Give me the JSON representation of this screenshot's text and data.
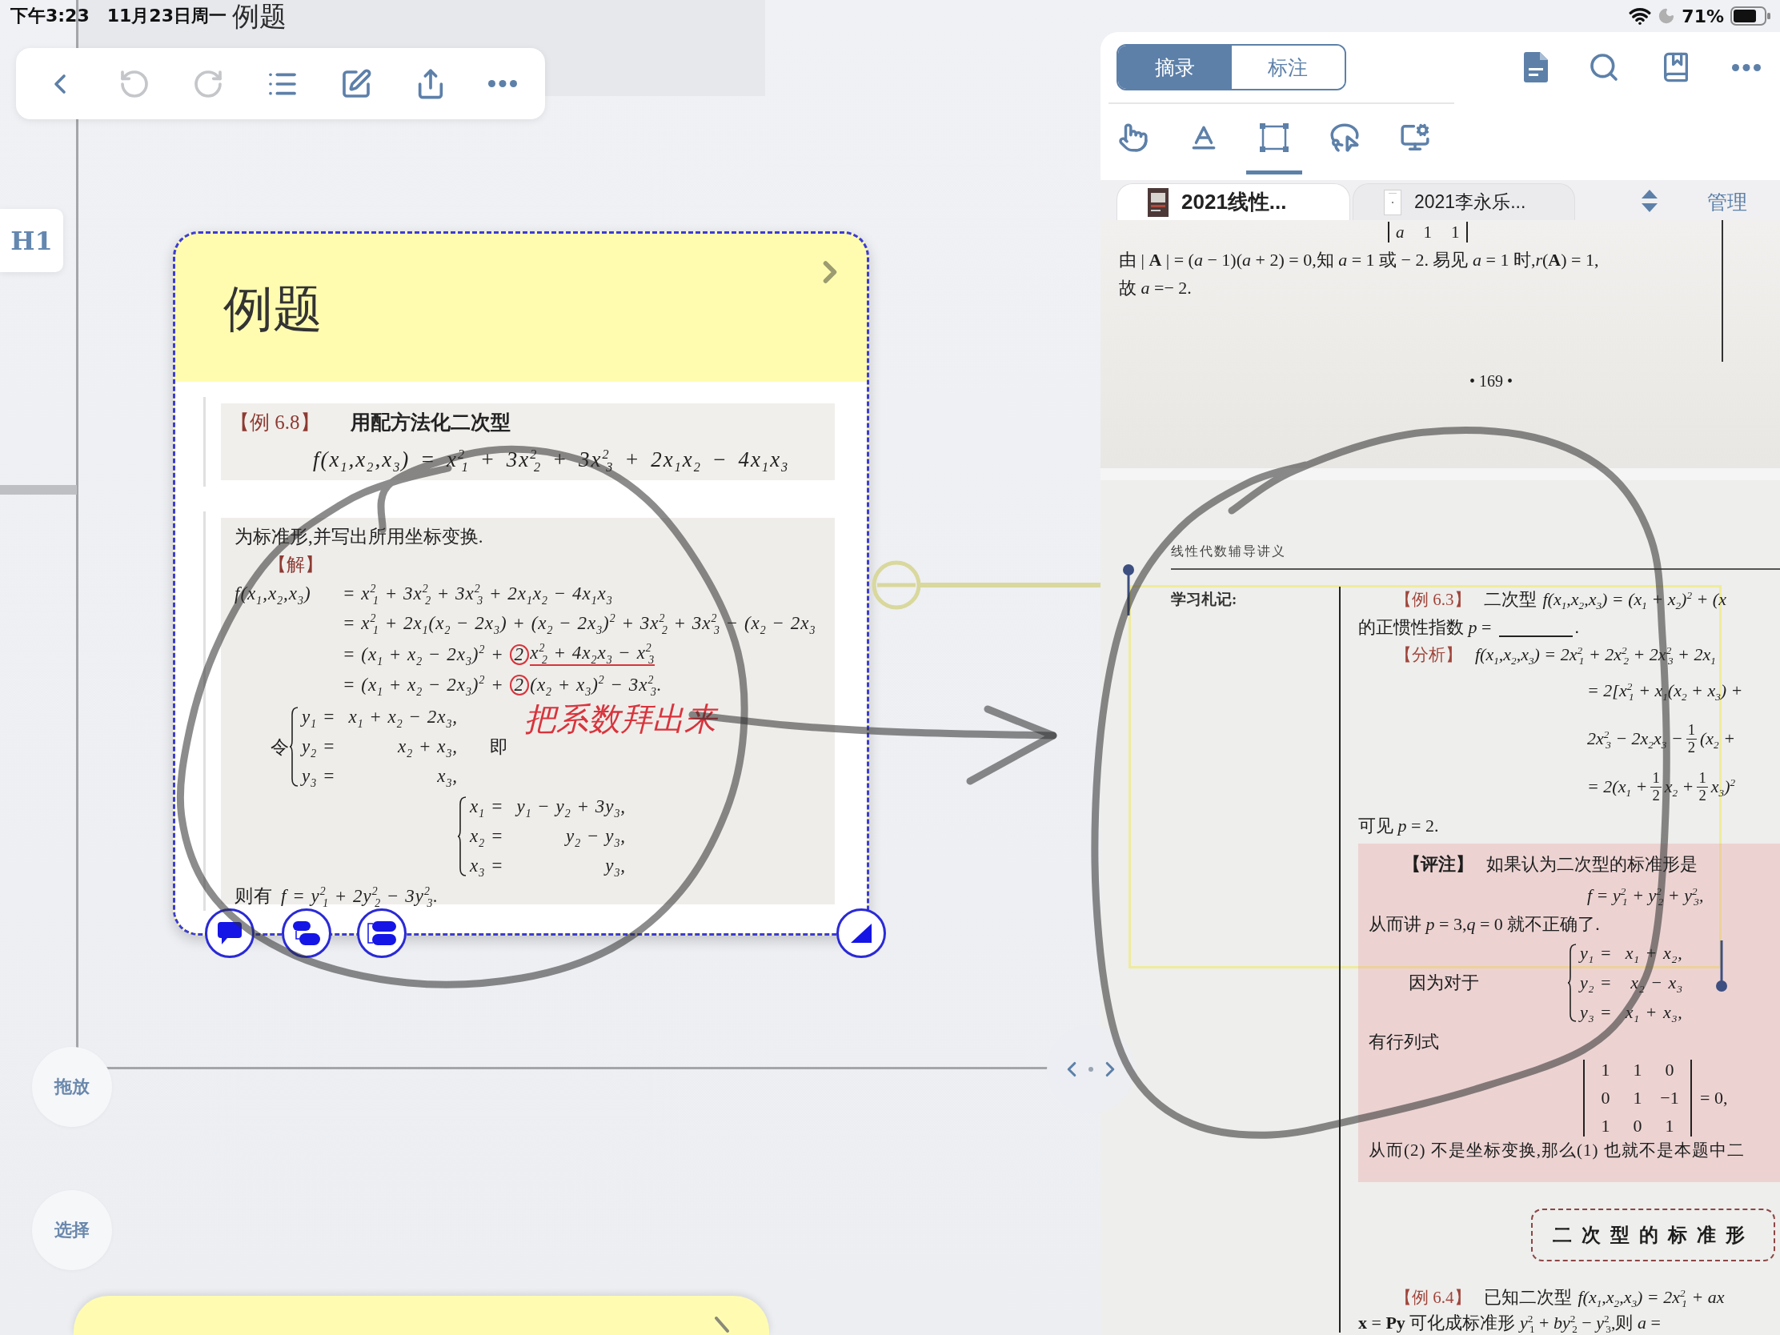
{
  "status_bar": {
    "time": "下午3:23",
    "date": "11月23日周一",
    "battery": "71%"
  },
  "background_card": {
    "title": "例题"
  },
  "toolbar": {
    "buttons": [
      {
        "disabled": false
      },
      {
        "disabled": true
      },
      {
        "disabled": true
      },
      {
        "disabled": false
      },
      {
        "disabled": false
      },
      {
        "disabled": false
      },
      {
        "disabled": false
      }
    ]
  },
  "heading_button": {
    "label": "H1"
  },
  "card": {
    "title": "例题",
    "excerpt_1": {
      "tag": "【例 6.8】",
      "title": "用配方法化二次型",
      "formula": "f(x$_{1}$,x$_{2}$,x$_{3}$) = x$^{2}$$_{1}$ + 3x$^{2}$$_{2}$ + 3x$^{2}$$_{3}$ + 2x$_{1}$x$_{2}$ − 4x$_{1}$x$_{3}$"
    },
    "excerpt_2": {
      "intro": "为标准形,并写出所用坐标变换.",
      "tag": "【解】",
      "derivation": {
        "head": "f(x$_{1}$,x$_{2}$,x$_{3}$)",
        "lines": [
          [
            {
              "kind": "text",
              "text": "= x$^{2}$$_{1}$ + 3x$^{2}$$_{2}$ + 3x$^{2}$$_{3}$ + 2x$_{1}$x$_{2}$ − 4x$_{1}$x$_{3}$"
            }
          ],
          [
            {
              "kind": "text",
              "text": "= x$^{2}$$_{1}$ + 2x$_{1}$(x$_{2}$ − 2x$_{3}$) + (x$_{2}$ − 2x$_{3}$)$^{2}$ + 3x$^{2}$$_{2}$ + 3x$^{2}$$_{3}$ − (x$_{2}$ − 2x$_{3}$"
            }
          ],
          [
            {
              "kind": "text",
              "text": "= (x$_{1}$ + x$_{2}$ − 2x$_{3}$)$^{2}$ +"
            },
            {
              "kind": "circled",
              "text": "2"
            },
            {
              "kind": "underlined",
              "text": "x$^{2}$$_{2}$ + 4x$_{2}$x$_{3}$ − x$^{2}$$_{3}$"
            }
          ],
          [
            {
              "kind": "text",
              "text": "= (x$_{1}$ + x$_{2}$ − 2x$_{3}$)$^{2}$ +"
            },
            {
              "kind": "circled",
              "text": "2"
            },
            {
              "kind": "text",
              "text": "(x$_{2}$ + x$_{3}$)$^{2}$ − 3x$^{2}$$_{3}$."
            }
          ]
        ]
      },
      "let": "令",
      "substitution": [
        {
          "lhs": "y$_{1}$ =",
          "rhs": "x$_{1}$ + x$_{2}$ − 2x$_{3}$,"
        },
        {
          "lhs": "y$_{2}$ =",
          "rhs": "x$_{2}$ + x$_{3}$,"
        },
        {
          "lhs": "y$_{3}$ =",
          "rhs": "x$_{3}$,"
        }
      ],
      "hence": "即",
      "inverse": [
        {
          "lhs": "x$_{1}$ =",
          "rhs": "y$_{1}$ − y$_{2}$ + 3y$_{3}$,"
        },
        {
          "lhs": "x$_{2}$ =",
          "rhs": "y$_{2}$ − y$_{3}$,"
        },
        {
          "lhs": "x$_{3}$ =",
          "rhs": "y$_{3}$,"
        }
      ],
      "result": {
        "lead": "则有",
        "formula": "f = y$^{2}$$_{1}$ + 2y$^{2}$$_{2}$ − 3y$^{2}$$_{3}$."
      }
    },
    "handwritten_note": "把系数拜出来"
  },
  "side_buttons": [
    {
      "label": "拖放"
    },
    {
      "label": "选择"
    }
  ],
  "panel": {
    "modes": [
      {
        "label": "摘录",
        "selected": true
      },
      {
        "label": "标注",
        "selected": false
      }
    ],
    "tools": [
      {
        "selected": false
      },
      {
        "selected": false
      },
      {
        "selected": true
      },
      {
        "selected": false
      },
      {
        "selected": false
      }
    ],
    "doc_tabs": [
      {
        "label": "2021线性...",
        "selected": true
      },
      {
        "label": "2021李永乐...",
        "selected": false
      }
    ],
    "manage": "管理",
    "page_1": {
      "matrix_row": [
        "*a*",
        "1",
        "1"
      ],
      "lines": [
        "由 | **A** | = (*a* − 1)(*a* + 2) = 0,知 *a* = 1 或 − 2. 易见 *a* = 1 时,*r*(**A**) = 1,",
        "故 *a* =− 2."
      ],
      "page_number": "• 169 •"
    },
    "page_2": {
      "header": "线性代数辅导讲义",
      "margin_label": "学习札记:",
      "example": {
        "tag": "【例 6.3】",
        "text": "二次型",
        "formula": "f(x$_{1}$,x$_{2}$,x$_{3}$) = (x$_{1}$ + x$_{2}$)$^{2}$ + (x"
      },
      "question": {
        "before": "的正惯性指数 *p* =",
        "after": "."
      },
      "analysis": {
        "tag": "【分析】",
        "head": "f(x$_{1}$,x$_{2}$,x$_{3}$) = 2x$^{2}$$_{1}$ + 2x$^{2}$$_{2}$ + 2x$^{2}$$_{3}$ + 2x$_{1}$",
        "lines": [
          [
            {
              "kind": "text",
              "text": "= 2[x$^{2}$$_{1}$ + x$_{1}$(x$_{2}$ + x$_{3}$) +"
            }
          ],
          [
            {
              "kind": "text",
              "text": "2x$^{2}$$_{3}$ − 2x$_{2}$x$_{3}$ −"
            },
            {
              "kind": "frac",
              "num": "1",
              "den": "2"
            },
            {
              "kind": "text",
              "text": "(x$_{2}$ +"
            }
          ],
          [
            {
              "kind": "text",
              "text": "= 2(x$_{1}$ +"
            },
            {
              "kind": "frac",
              "num": "1",
              "den": "2"
            },
            {
              "kind": "text",
              "text": "x$_{2}$ +"
            },
            {
              "kind": "frac",
              "num": "1",
              "den": "2"
            },
            {
              "kind": "text",
              "text": "x$_{3}$)$^{2}$"
            }
          ]
        ]
      },
      "conclusion": "可见 *p* = 2.",
      "remark": {
        "tag": "【评注】",
        "text": "如果认为二次型的标准形是",
        "formula": "f = y$^{2}$$_{1}$ + y$^{2}$$_{2}$ + y$^{2}$$_{3}$,",
        "consequence": "从而讲 *p* = 3,*q* = 0 就不正确了.",
        "because": "因为对于",
        "system": [
          {
            "lhs": "y$_{1}$ =",
            "rhs": "x$_{1}$ + x$_{2}$,"
          },
          {
            "lhs": "y$_{2}$ =",
            "rhs": "x$_{2}$ − x$_{3}$"
          },
          {
            "lhs": "y$_{3}$ =",
            "rhs": "x$_{1}$ + x$_{3}$,"
          }
        ],
        "determinant_intro": "有行列式",
        "determinant": [
          [
            "1",
            "1",
            "0"
          ],
          [
            "0",
            "1",
            "−1"
          ],
          [
            "1",
            "0",
            "1"
          ]
        ],
        "determinant_value": "= 0,",
        "conclusion": "从而(2) 不是坐标变换,那么(1) 也就不是本题中二"
      },
      "section_title": "二次型的标准形",
      "next_example": {
        "tag": "【例 6.4】",
        "text": "已知二次型",
        "formula": "f(x$_{1}$,x$_{2}$,x$_{3}$) = 2x$^{2}$$_{1}$ + ax"
      },
      "last_line": "**x** = **Py** 可化成标准形 *y*$^{2}$$_{1}$ + *by*$^{2}$$_{2}$ − *y*$^{2}$$_{3}$,则 *a* ="
    }
  }
}
